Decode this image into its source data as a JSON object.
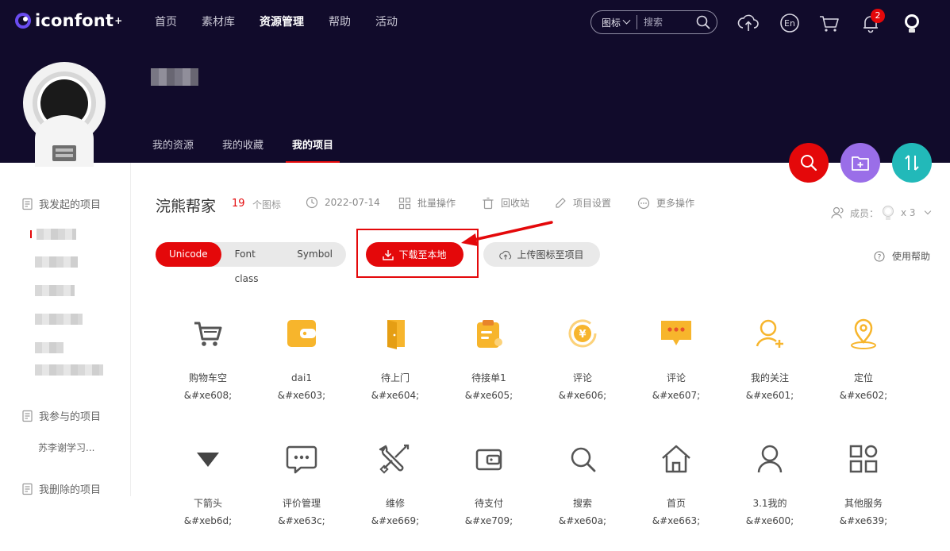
{
  "header": {
    "logo_text": "iconfont",
    "logo_plus": "+",
    "nav": [
      "首页",
      "素材库",
      "资源管理",
      "帮助",
      "活动"
    ],
    "nav_active": 2,
    "search_type": "图标",
    "search_placeholder": "搜索",
    "notification_count": "2"
  },
  "profile": {
    "tabs": [
      "我的资源",
      "我的收藏",
      "我的项目"
    ],
    "active_tab": 2
  },
  "sidebar": {
    "my_projects_label": "我发起的项目",
    "joined_label": "我参与的项目",
    "joined_item": "苏李谢学习...",
    "deleted_label": "我删除的项目"
  },
  "project": {
    "title": "浣熊帮家",
    "icon_count": "19",
    "icon_count_label": "个图标",
    "date": "2022-07-14",
    "batch_label": "批量操作",
    "recycle_label": "回收站",
    "settings_label": "项目设置",
    "more_label": "更多操作",
    "members_label": "成员：",
    "members_count": "x 3",
    "help_label": "使用帮助"
  },
  "toolbar": {
    "tabs": [
      "Unicode",
      "Font class",
      "Symbol"
    ],
    "active_tab": 0,
    "download_label": "下载至本地",
    "upload_label": "上传图标至项目"
  },
  "colors": {
    "header_bg": "#110b2b",
    "accent_red": "#e4080a",
    "fab_purple": "#9a6ee8",
    "fab_teal": "#22b9b9",
    "icon_yellow": "#f7b52c",
    "icon_gray": "#555555"
  },
  "icons": [
    {
      "name": "购物车空",
      "code": "&#xe608;",
      "glyph": "cart-icon"
    },
    {
      "name": "dai1",
      "code": "&#xe603;",
      "glyph": "wallet-yellow-icon"
    },
    {
      "name": "待上门",
      "code": "&#xe604;",
      "glyph": "door-icon"
    },
    {
      "name": "待接单1",
      "code": "&#xe605;",
      "glyph": "clipboard-icon"
    },
    {
      "name": "评论",
      "code": "&#xe606;",
      "glyph": "yen-refresh-icon"
    },
    {
      "name": "评论",
      "code": "&#xe607;",
      "glyph": "chat-bubble-icon"
    },
    {
      "name": "我的关注",
      "code": "&#xe601;",
      "glyph": "user-add-icon"
    },
    {
      "name": "定位",
      "code": "&#xe602;",
      "glyph": "location-icon"
    },
    {
      "name": "下箭头",
      "code": "&#xeb6d;",
      "glyph": "triangle-down-icon"
    },
    {
      "name": "评价管理",
      "code": "&#xe63c;",
      "glyph": "comment-icon"
    },
    {
      "name": "维修",
      "code": "&#xe669;",
      "glyph": "tools-icon"
    },
    {
      "name": "待支付",
      "code": "&#xe709;",
      "glyph": "wallet-icon"
    },
    {
      "name": "搜索",
      "code": "&#xe60a;",
      "glyph": "search-icon"
    },
    {
      "name": "首页",
      "code": "&#xe663;",
      "glyph": "home-icon"
    },
    {
      "name": "3.1我的",
      "code": "&#xe600;",
      "glyph": "user-icon"
    },
    {
      "name": "其他服务",
      "code": "&#xe639;",
      "glyph": "grid-icon"
    }
  ]
}
